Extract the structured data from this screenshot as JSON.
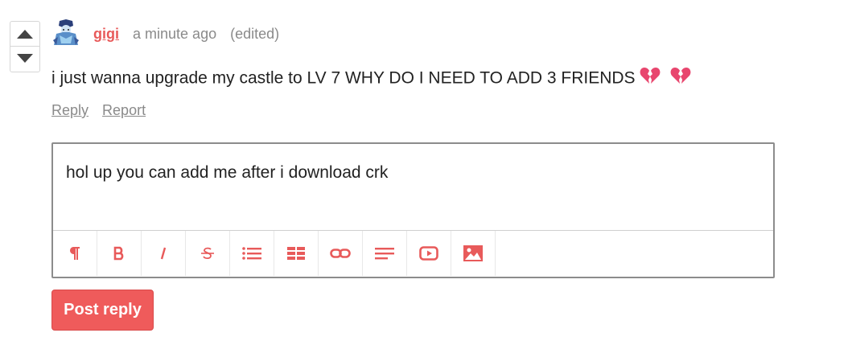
{
  "comment": {
    "author": "gigi",
    "time": "a minute ago",
    "edited": "(edited)",
    "text": "i just wanna upgrade my castle to LV 7 WHY DO I NEED TO ADD 3 FRIENDS",
    "emojis": [
      "broken-heart",
      "broken-heart"
    ],
    "actions": {
      "reply": "Reply",
      "report": "Report"
    }
  },
  "vote": {
    "up_icon": "triangle-up-icon",
    "down_icon": "triangle-down-icon"
  },
  "editor": {
    "value": "hol up you can add me after i download crk",
    "toolbar_icons": [
      "paragraph-icon",
      "bold-icon",
      "italic-icon",
      "strikethrough-icon",
      "bullet-list-icon",
      "table-icon",
      "link-icon",
      "align-icon",
      "video-icon",
      "image-icon"
    ]
  },
  "post_button": "Post reply",
  "colors": {
    "accent": "#e85a5a",
    "button_bg": "#ef5b5b",
    "muted": "#8a8a8a",
    "text": "#222222"
  }
}
